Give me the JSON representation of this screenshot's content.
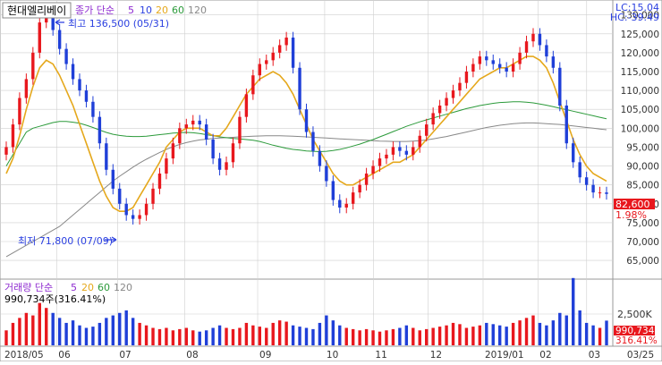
{
  "header": {
    "stock_name": "현대엘리베이",
    "indicator_prefix": "종가 단순",
    "ma_periods": [
      "5",
      "10",
      "20",
      "60",
      "120"
    ],
    "lc_text": "LC:15.04",
    "hc_text": "HC:-39.49"
  },
  "annotations": {
    "high": "최고 136,500 (05/31)",
    "low": "최저 71,800 (07/09)"
  },
  "price_panel": {
    "last_price": "82,600",
    "change_pct": "1.98%",
    "y_ticks": [
      "130,000",
      "125,000",
      "120,000",
      "115,000",
      "110,000",
      "105,000",
      "100,000",
      "95,000",
      "90,000",
      "85,000",
      "80,000",
      "75,000",
      "70,000",
      "65,000"
    ]
  },
  "volume_panel": {
    "title_prefix": "거래량 단순",
    "ma_periods": [
      "5",
      "20",
      "60",
      "120"
    ],
    "value_text": "990,734주(316.41%)",
    "y_tick": "2,500K",
    "last_value": "990,734",
    "last_pct": "316.41%"
  },
  "x_axis": {
    "labels": [
      "2018/05",
      "06",
      "07",
      "08",
      "09",
      "10",
      "11",
      "12",
      "2019/01",
      "02",
      "03",
      "03/25"
    ]
  },
  "colors": {
    "up": "#e8171d",
    "down": "#1f3fd8",
    "ma5": "#8e2bd0",
    "ma10": "#2a3fe0",
    "ma20": "#e5a81c",
    "ma60": "#2b9a3a",
    "ma120": "#888888",
    "grid": "#cfcfcf",
    "axis_text": "#333333",
    "highlight": "#e8171d"
  },
  "chart_data": {
    "type": "candlestick",
    "title": "현대엘리베이",
    "x_axis_labels": [
      "2018/05",
      "06",
      "07",
      "08",
      "09",
      "10",
      "11",
      "12",
      "2019/01",
      "02",
      "03",
      "03/25"
    ],
    "ylim": [
      61000,
      133000
    ],
    "price_close": [
      95000,
      101000,
      108000,
      113000,
      120000,
      128000,
      131000,
      126000,
      121000,
      117000,
      113000,
      110000,
      107000,
      103000,
      96000,
      89000,
      84000,
      80000,
      77000,
      76000,
      77000,
      80000,
      84000,
      88000,
      92000,
      96000,
      100000,
      101000,
      102000,
      101000,
      97000,
      92000,
      89000,
      91000,
      96000,
      103000,
      109000,
      114000,
      117000,
      118000,
      120000,
      122000,
      124000,
      116000,
      105000,
      99000,
      94000,
      90000,
      86000,
      81000,
      79000,
      80000,
      83000,
      85000,
      88000,
      90000,
      92000,
      93000,
      95000,
      94000,
      93000,
      95000,
      98000,
      101000,
      104000,
      106000,
      108000,
      110000,
      112000,
      115000,
      117000,
      119000,
      118000,
      117000,
      116000,
      115000,
      117000,
      120000,
      123000,
      125000,
      122000,
      119000,
      116000,
      106000,
      96000,
      91000,
      87000,
      85000,
      83000,
      83000,
      82600
    ],
    "ma20_line": [
      88000,
      92000,
      98000,
      105000,
      111000,
      116000,
      118000,
      117000,
      114000,
      110000,
      106000,
      101000,
      96000,
      91000,
      86000,
      82000,
      79000,
      78000,
      78000,
      79000,
      82000,
      85000,
      88000,
      91000,
      95000,
      97000,
      99000,
      100000,
      100000,
      100000,
      99000,
      98000,
      98000,
      100000,
      103000,
      106000,
      109000,
      111000,
      113000,
      114000,
      115000,
      114000,
      112000,
      109000,
      105000,
      101000,
      97000,
      94000,
      91000,
      88000,
      86000,
      85000,
      85000,
      86000,
      87000,
      88000,
      89000,
      90000,
      91000,
      91000,
      92000,
      93000,
      95000,
      97000,
      99000,
      101000,
      103000,
      105000,
      107000,
      109000,
      111000,
      113000,
      114000,
      115000,
      116000,
      116000,
      117000,
      118000,
      119000,
      119000,
      118000,
      116000,
      112000,
      107000,
      102000,
      97000,
      93000,
      90000,
      88000,
      87000,
      86000
    ],
    "ma60_line": [
      90000,
      93000,
      96000,
      99000,
      100000,
      100500,
      101000,
      101500,
      101800,
      101800,
      101600,
      101300,
      100800,
      100200,
      99500,
      98900,
      98400,
      98100,
      97900,
      97800,
      97800,
      97900,
      98100,
      98300,
      98500,
      98700,
      98800,
      98900,
      98800,
      98600,
      98300,
      98000,
      97700,
      97500,
      97300,
      97200,
      97000,
      96800,
      96500,
      96000,
      95500,
      95100,
      94700,
      94400,
      94200,
      94000,
      93900,
      93800,
      93900,
      94100,
      94400,
      94800,
      95300,
      95800,
      96400,
      97000,
      97700,
      98400,
      99100,
      99800,
      100500,
      101100,
      101700,
      102200,
      102700,
      103200,
      103700,
      104200,
      104700,
      105200,
      105600,
      106000,
      106300,
      106600,
      106800,
      106900,
      107000,
      107000,
      106900,
      106700,
      106400,
      106100,
      105700,
      105300,
      104900,
      104500,
      104100,
      103700,
      103300,
      102900,
      102500
    ],
    "ma120_line": [
      66000,
      67000,
      68000,
      69000,
      70000,
      71000,
      72000,
      73000,
      74000,
      75500,
      77000,
      78500,
      80000,
      81500,
      83000,
      84500,
      86000,
      87300,
      88500,
      89700,
      90800,
      91800,
      92700,
      93600,
      94400,
      95100,
      95700,
      96200,
      96600,
      96900,
      97100,
      97300,
      97400,
      97500,
      97600,
      97700,
      97800,
      97900,
      97950,
      98000,
      98000,
      98000,
      97950,
      97900,
      97800,
      97700,
      97600,
      97500,
      97400,
      97300,
      97200,
      97100,
      97000,
      96900,
      96800,
      96700,
      96600,
      96550,
      96500,
      96500,
      96500,
      96600,
      96700,
      96900,
      97200,
      97500,
      97800,
      98200,
      98600,
      99000,
      99400,
      99800,
      100200,
      100500,
      100800,
      101000,
      101200,
      101300,
      101400,
      101400,
      101300,
      101200,
      101100,
      101000,
      100800,
      100600,
      100400,
      100200,
      100000,
      99800,
      99600
    ],
    "volume": [
      600,
      900,
      1100,
      1300,
      1200,
      1700,
      1500,
      1300,
      1100,
      900,
      1000,
      800,
      700,
      750,
      900,
      1100,
      1200,
      1300,
      1400,
      1100,
      900,
      800,
      700,
      650,
      700,
      600,
      650,
      700,
      600,
      550,
      600,
      700,
      800,
      700,
      650,
      700,
      900,
      800,
      750,
      700,
      900,
      1000,
      950,
      800,
      750,
      700,
      650,
      900,
      1200,
      1000,
      800,
      700,
      650,
      600,
      650,
      600,
      550,
      600,
      650,
      700,
      800,
      700,
      600,
      650,
      700,
      750,
      800,
      900,
      850,
      700,
      750,
      800,
      900,
      850,
      800,
      750,
      900,
      1000,
      1100,
      1200,
      900,
      800,
      1000,
      1300,
      1200,
      2700,
      1400,
      900,
      800,
      700,
      990.734
    ],
    "volume_unit": "K",
    "last_close": 82600,
    "high": {
      "value": 136500,
      "date": "05/31"
    },
    "low": {
      "value": 71800,
      "date": "07/09"
    }
  }
}
